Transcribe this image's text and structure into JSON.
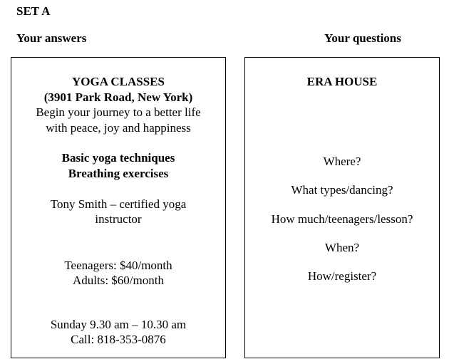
{
  "set_title": "SET A",
  "headings": {
    "answers": "Your answers",
    "questions": "Your questions"
  },
  "answers_card": {
    "title": "YOGA CLASSES",
    "address": "(3901 Park Road, New York)",
    "tagline_line1": "Begin your journey to a better life",
    "tagline_line2": "with peace, joy and happiness",
    "feature1": "Basic yoga techniques",
    "feature2": "Breathing exercises",
    "instructor_line1": "Tony Smith – certified yoga",
    "instructor_line2": "instructor",
    "price_teen": "Teenagers: $40/month",
    "price_adult": "Adults: $60/month",
    "schedule": "Sunday  9.30 am – 10.30 am",
    "phone": "Call: 818-353-0876"
  },
  "questions_card": {
    "title": "ERA HOUSE",
    "questions": [
      "Where?",
      "What types/dancing?",
      "How much/teenagers/lesson?",
      "When?",
      "How/register?"
    ]
  }
}
